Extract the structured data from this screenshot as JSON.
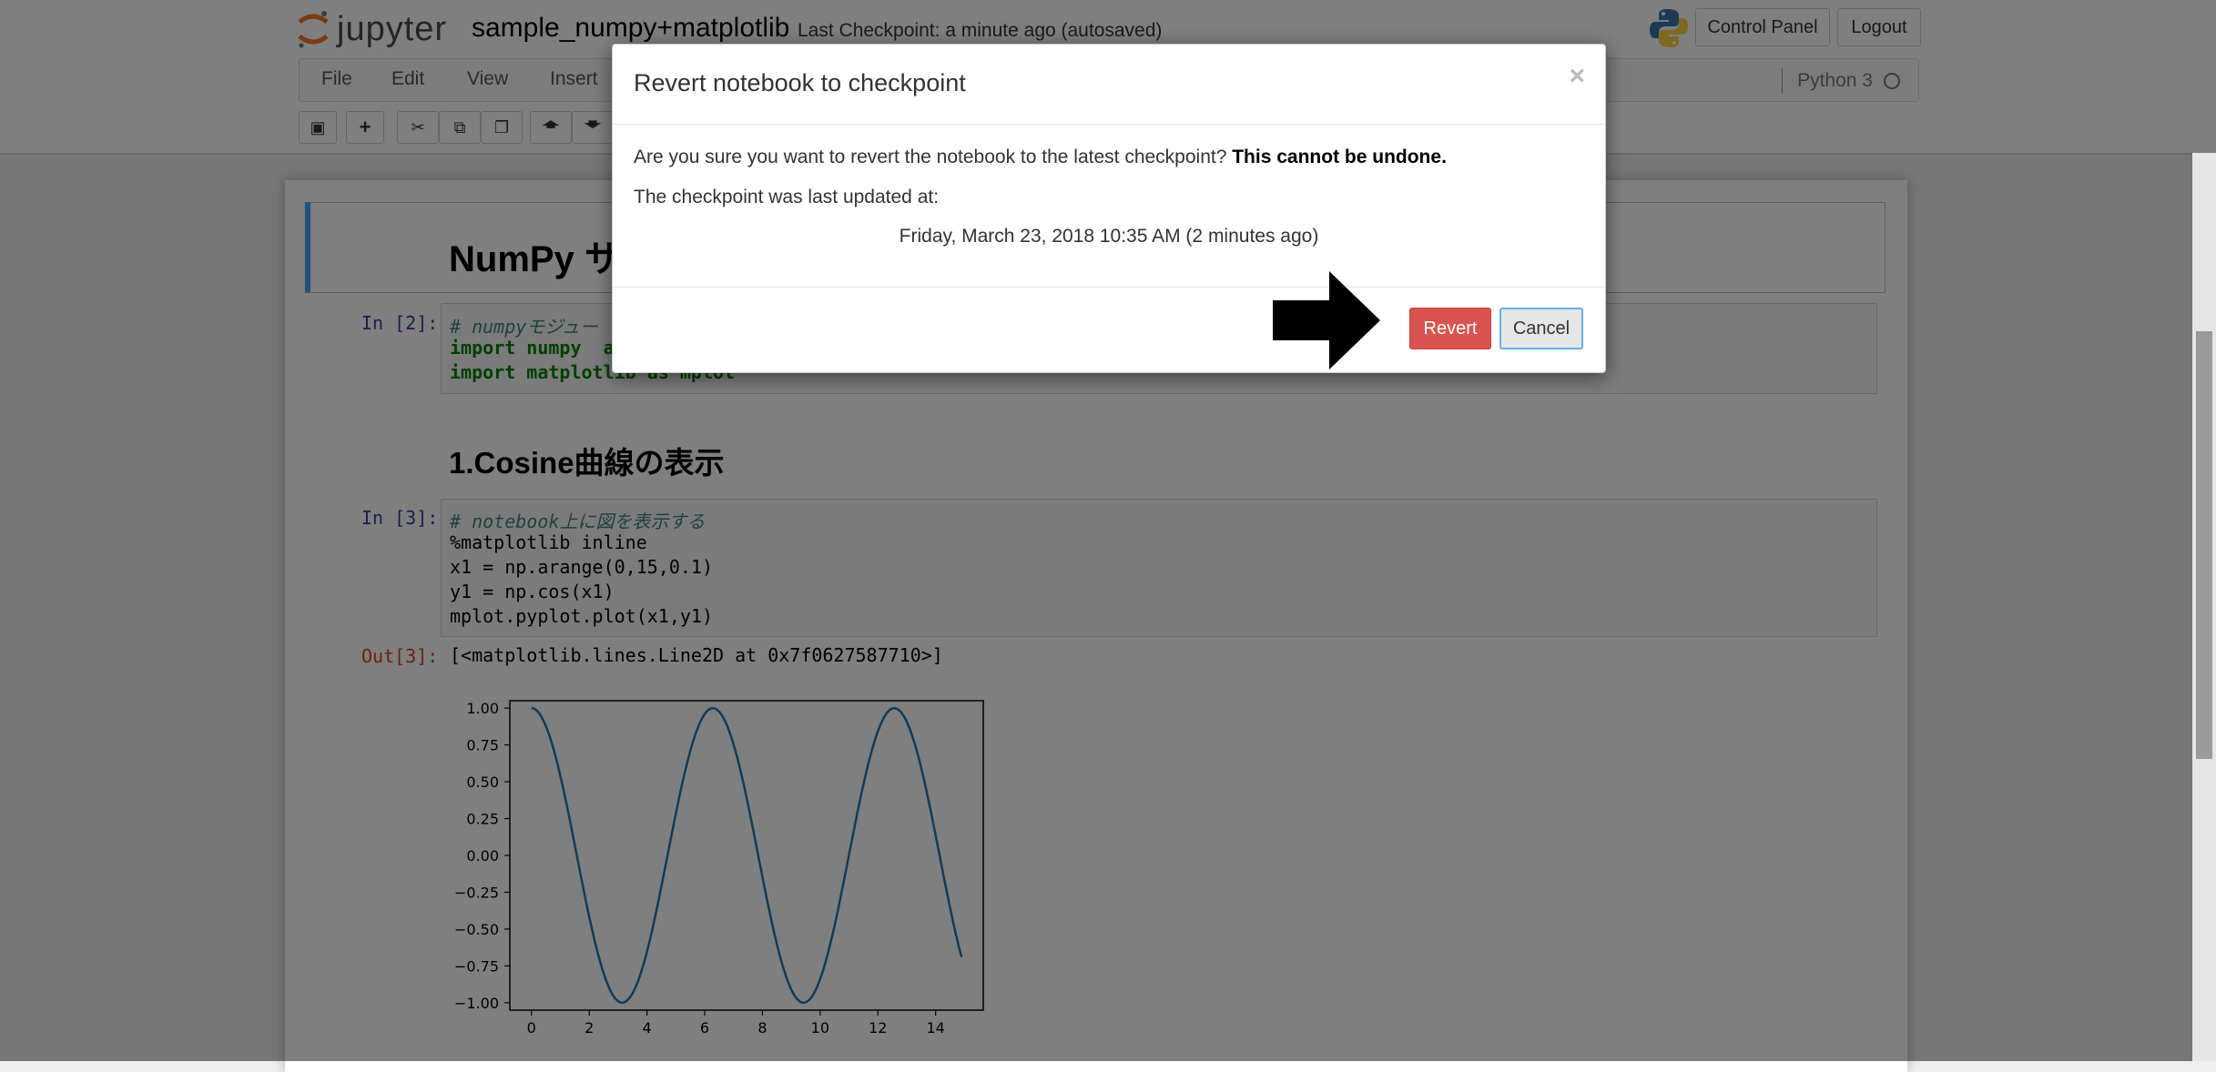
{
  "header": {
    "logo_text": "jupyter",
    "notebook_name": "sample_numpy+matplotlib",
    "checkpoint_status": "Last Checkpoint: a minute ago (autosaved)",
    "control_panel_label": "Control Panel",
    "logout_label": "Logout"
  },
  "menubar": {
    "items": [
      "File",
      "Edit",
      "View",
      "Insert"
    ],
    "kernel_name": "Python 3"
  },
  "toolbar": {
    "icons": [
      "save-icon",
      "plus-icon",
      "cut-icon",
      "copy-icon",
      "paste-icon",
      "arrow-up-icon",
      "arrow-down-icon"
    ]
  },
  "notebook": {
    "heading1": "NumPy サ",
    "cell1_prompt": "In [2]:",
    "cell1_lines": [
      "# numpyモジュー",
      "import numpy  as",
      "import matplotlib as mplot"
    ],
    "heading2": "1.Cosine曲線の表示",
    "cell2_prompt": "In [3]:",
    "cell2_lines": [
      "# notebook上に図を表示する",
      "%matplotlib inline",
      "x1 = np.arange(0,15,0.1)",
      "y1 = np.cos(x1)",
      "mplot.pyplot.plot(x1,y1)"
    ],
    "out_prompt": "Out[3]:",
    "out_text": "[<matplotlib.lines.Line2D at 0x7f0627587710>]"
  },
  "chart_data": {
    "type": "line",
    "title": "",
    "xlabel": "",
    "ylabel": "",
    "xlim": [
      -0.75,
      15.65
    ],
    "ylim": [
      -1.05,
      1.05
    ],
    "x_ticks": [
      "0",
      "2",
      "4",
      "6",
      "8",
      "10",
      "12",
      "14"
    ],
    "y_ticks": [
      "1.00",
      "0.75",
      "0.50",
      "0.25",
      "0.00",
      "−0.25",
      "−0.50",
      "−0.75",
      "−1.00"
    ],
    "series": [
      {
        "function": "cos",
        "x_start": 0,
        "x_end": 14.9,
        "x_step": 0.1
      }
    ],
    "grid": false,
    "line_color": "#1f77b4"
  },
  "modal": {
    "title": "Revert notebook to checkpoint",
    "close_glyph": "×",
    "message": "Are you sure you want to revert the notebook to the latest checkpoint?",
    "warning": "This cannot be undone.",
    "updated_label": "The checkpoint was last updated at:",
    "updated_time": "Friday, March 23, 2018 10:35 AM (2 minutes ago)",
    "revert_label": "Revert",
    "cancel_label": "Cancel"
  }
}
